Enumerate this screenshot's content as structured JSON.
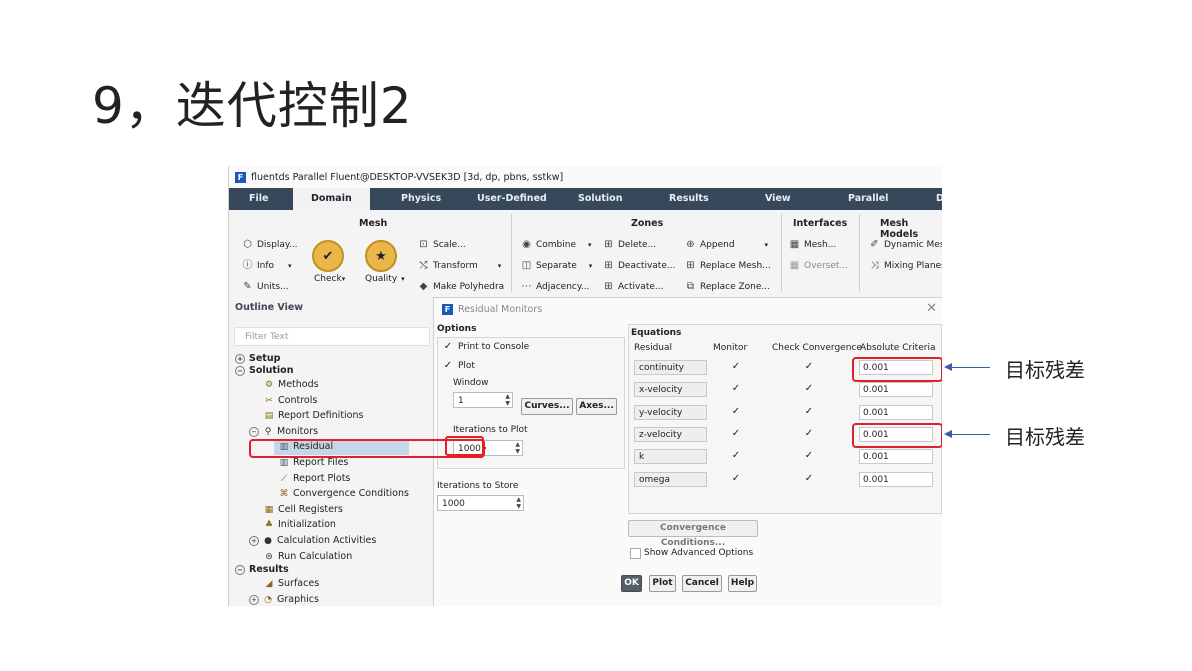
{
  "slide": {
    "title": "9，迭代控制2"
  },
  "window": {
    "title": "fluentds Parallel Fluent@DESKTOP-VVSEK3D  [3d, dp, pbns, sstkw]"
  },
  "menu": {
    "file": "File",
    "domain": "Domain",
    "physics": "Physics",
    "user_defined": "User-Defined",
    "solution": "Solution",
    "results": "Results",
    "view": "View",
    "parallel": "Parallel",
    "more": "D"
  },
  "ribbon": {
    "mesh": {
      "title": "Mesh",
      "display": "Display...",
      "info": "Info",
      "units": "Units...",
      "check": "Check",
      "quality": "Quality",
      "scale": "Scale...",
      "transform": "Transform",
      "make_polyhedra": "Make Polyhedra"
    },
    "zones": {
      "title": "Zones",
      "combine": "Combine",
      "separate": "Separate",
      "adjacency": "Adjacency...",
      "delete": "Delete...",
      "deactivate": "Deactivate...",
      "activate": "Activate...",
      "append": "Append",
      "replace_mesh": "Replace Mesh...",
      "replace_zone": "Replace Zone..."
    },
    "interfaces": {
      "title": "Interfaces",
      "mesh": "Mesh...",
      "overset": "Overset..."
    },
    "mesh_models": {
      "title": "Mesh Models",
      "dynamic_mesh": "Dynamic Mesh",
      "mixing_planes": "Mixing Planes"
    }
  },
  "outline": {
    "title": "Outline View",
    "filter_placeholder": "Filter Text",
    "items": {
      "setup": "Setup",
      "solution": "Solution",
      "methods": "Methods",
      "controls": "Controls",
      "report_definitions": "Report Definitions",
      "monitors": "Monitors",
      "residual": "Residual",
      "report_files": "Report Files",
      "report_plots": "Report Plots",
      "convergence_conditions": "Convergence Conditions",
      "cell_registers": "Cell Registers",
      "initialization": "Initialization",
      "calculation_activities": "Calculation Activities",
      "run_calculation": "Run Calculation",
      "results": "Results",
      "surfaces": "Surfaces",
      "graphics": "Graphics"
    }
  },
  "dialog": {
    "title": "Residual Monitors",
    "options": {
      "title": "Options",
      "print_to_console": "Print to Console",
      "plot": "Plot",
      "window_label": "Window",
      "window_value": "1",
      "curves": "Curves...",
      "axes": "Axes...",
      "iter_plot_label": "Iterations to Plot",
      "iter_plot_value": "1000"
    },
    "iter_store_label": "Iterations to Store",
    "iter_store_value": "1000",
    "equations": {
      "title": "Equations",
      "headers": {
        "residual": "Residual",
        "monitor": "Monitor",
        "check": "Check Convergence",
        "criteria": "Absolute Criteria"
      },
      "rows": [
        {
          "name": "continuity",
          "criteria": "0.001"
        },
        {
          "name": "x-velocity",
          "criteria": "0.001"
        },
        {
          "name": "y-velocity",
          "criteria": "0.001"
        },
        {
          "name": "z-velocity",
          "criteria": "0.001"
        },
        {
          "name": "k",
          "criteria": "0.001"
        },
        {
          "name": "omega",
          "criteria": "0.001"
        }
      ]
    },
    "convergence_button": "Convergence Conditions...",
    "show_advanced": "Show Advanced Options",
    "buttons": {
      "ok": "OK",
      "plot": "Plot",
      "cancel": "Cancel",
      "help": "Help"
    }
  },
  "annotations": {
    "target_residual_1": "目标残差",
    "target_residual_2": "目标残差"
  },
  "colors": {
    "highlight": "#e0202a",
    "arrow": "#3a5fa8",
    "menubar": "#37485a"
  },
  "icons": {
    "app": "fluent-app-icon",
    "check": "checkmark-icon"
  }
}
